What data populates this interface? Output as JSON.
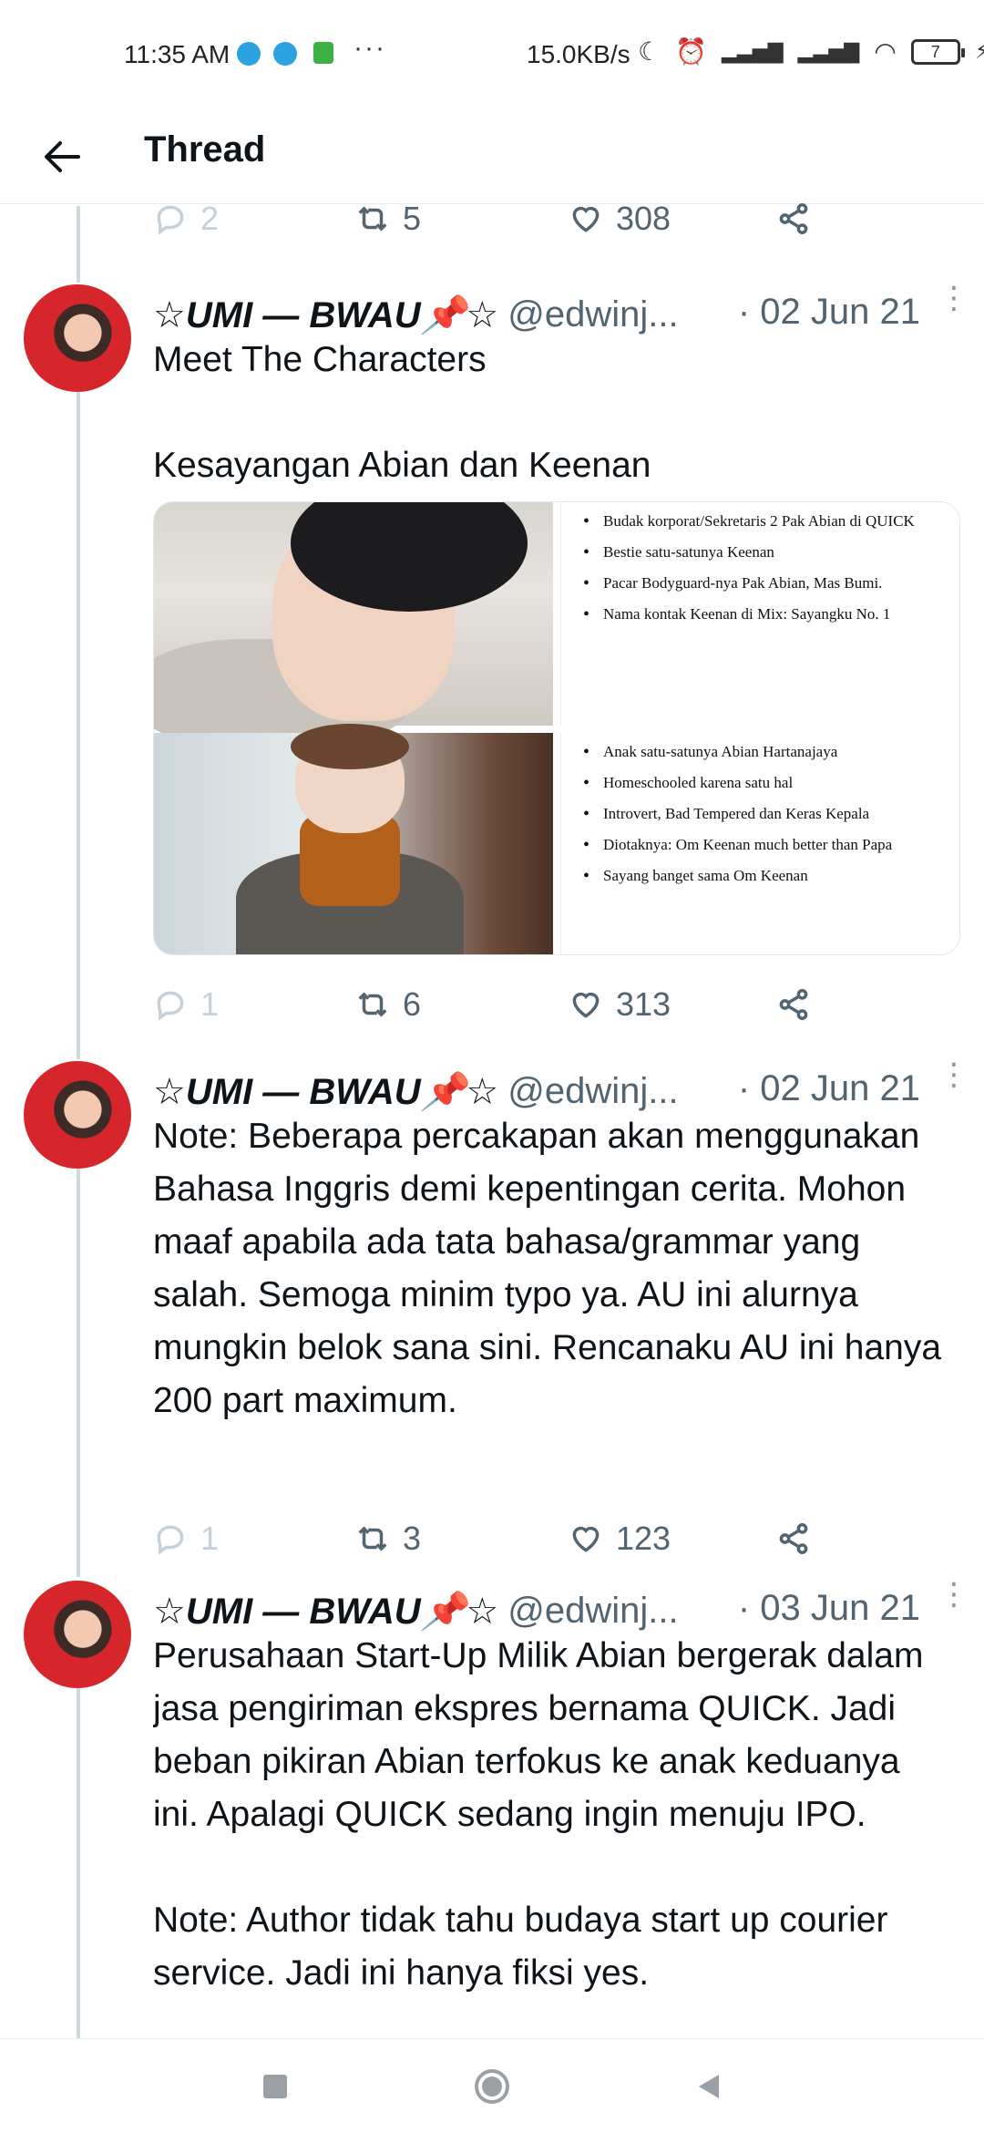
{
  "status_bar": {
    "time": "11:35 AM",
    "dots": "···",
    "net_speed": "15.0KB/s",
    "battery": "7"
  },
  "header": {
    "title": "Thread"
  },
  "top_actions": {
    "replies": "2",
    "retweets": "5",
    "likes": "308"
  },
  "tweets": [
    {
      "name": "☆UMI — BWAU📌☆",
      "handle": "@edwinj...",
      "date": "· 02 Jun 21",
      "text": "Meet The Characters\n\nKesayangan Abian dan Keenan",
      "media": {
        "card1": [
          "Budak korporat/Sekretaris 2 Pak Abian di QUICK",
          "Bestie satu-satunya Keenan",
          "Pacar Bodyguard-nya Pak Abian, Mas Bumi.",
          "Nama kontak Keenan di Mix: Sayangku No. 1"
        ],
        "card2": [
          "Anak satu-satunya Abian Hartanajaya",
          "Homeschooled karena satu hal",
          "Introvert, Bad Tempered dan Keras Kepala",
          "Diotaknya: Om Keenan much better than Papa",
          "Sayang banget sama Om Keenan"
        ]
      },
      "replies": "1",
      "retweets": "6",
      "likes": "313"
    },
    {
      "name": "☆UMI — BWAU📌☆",
      "handle": "@edwinj...",
      "date": "· 02 Jun 21",
      "text": "Note: Beberapa percakapan akan menggunakan Bahasa Inggris demi kepentingan cerita. Mohon maaf apabila ada tata bahasa/grammar yang salah. Semoga minim typo ya. AU ini alurnya mungkin belok sana sini. Rencanaku AU ini hanya 200 part maximum.",
      "replies": "1",
      "retweets": "3",
      "likes": "123"
    },
    {
      "name": "☆UMI — BWAU📌☆",
      "handle": "@edwinj...",
      "date": "· 03 Jun 21",
      "text": "Perusahaan Start-Up Milik Abian bergerak dalam jasa pengiriman ekspres bernama QUICK. Jadi beban pikiran Abian terfokus ke anak keduanya ini. Apalagi QUICK sedang ingin menuju IPO.\n\nNote: Author tidak tahu budaya start up courier service. Jadi ini hanya fiksi yes."
    }
  ]
}
